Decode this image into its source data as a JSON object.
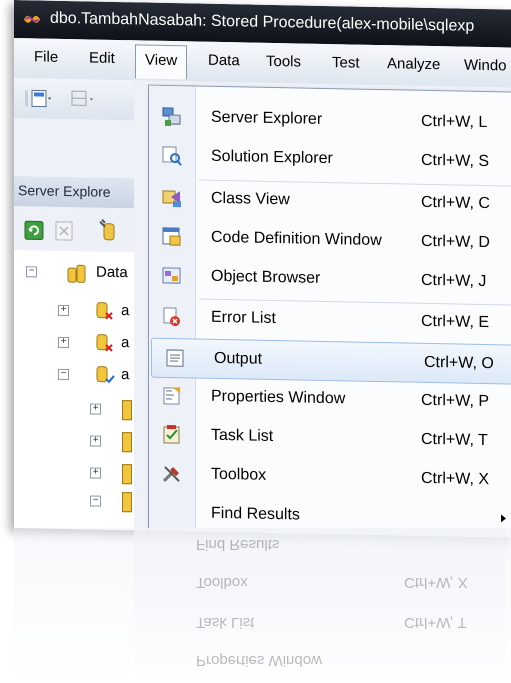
{
  "window": {
    "title": "dbo.TambahNasabah: Stored Procedure(alex-mobile\\sqlexp"
  },
  "menubar": {
    "items": [
      "File",
      "Edit",
      "View",
      "Data",
      "Tools",
      "Test",
      "Analyze",
      "Windo"
    ]
  },
  "server_explorer": {
    "header": "Server Explore",
    "tree": {
      "root_label": "Data",
      "child_labels": [
        "a",
        "a",
        "a"
      ]
    }
  },
  "view_menu": {
    "items": [
      {
        "label": "Server Explorer",
        "shortcut": "Ctrl+W, L",
        "icon": "server-explorer-icon"
      },
      {
        "label": "Solution Explorer",
        "shortcut": "Ctrl+W, S",
        "icon": "solution-explorer-icon"
      },
      {
        "label": "Class View",
        "shortcut": "Ctrl+W, C",
        "icon": "class-view-icon"
      },
      {
        "label": "Code Definition Window",
        "shortcut": "Ctrl+W, D",
        "icon": "code-definition-icon"
      },
      {
        "label": "Object Browser",
        "shortcut": "Ctrl+W, J",
        "icon": "object-browser-icon"
      },
      {
        "label": "Error List",
        "shortcut": "Ctrl+W, E",
        "icon": "error-list-icon"
      },
      {
        "label": "Output",
        "shortcut": "Ctrl+W, O",
        "icon": "output-icon"
      },
      {
        "label": "Properties Window",
        "shortcut": "Ctrl+W, P",
        "icon": "properties-icon"
      },
      {
        "label": "Task List",
        "shortcut": "Ctrl+W, T",
        "icon": "task-list-icon"
      },
      {
        "label": "Toolbox",
        "shortcut": "Ctrl+W, X",
        "icon": "toolbox-icon"
      },
      {
        "label": "Find Results",
        "shortcut": "",
        "icon": ""
      }
    ],
    "highlighted": "Output"
  },
  "reflection": {
    "labels": [
      "Find Results",
      "Toolbox",
      "Task List",
      "Properties Window"
    ],
    "shortcuts": [
      "Ctrl+W, X",
      "Ctrl+W, T"
    ]
  },
  "colors": {
    "titlebar": "#111520",
    "menu_highlight": "#dde9f8",
    "menu_highlight_border": "#9bbde6"
  }
}
